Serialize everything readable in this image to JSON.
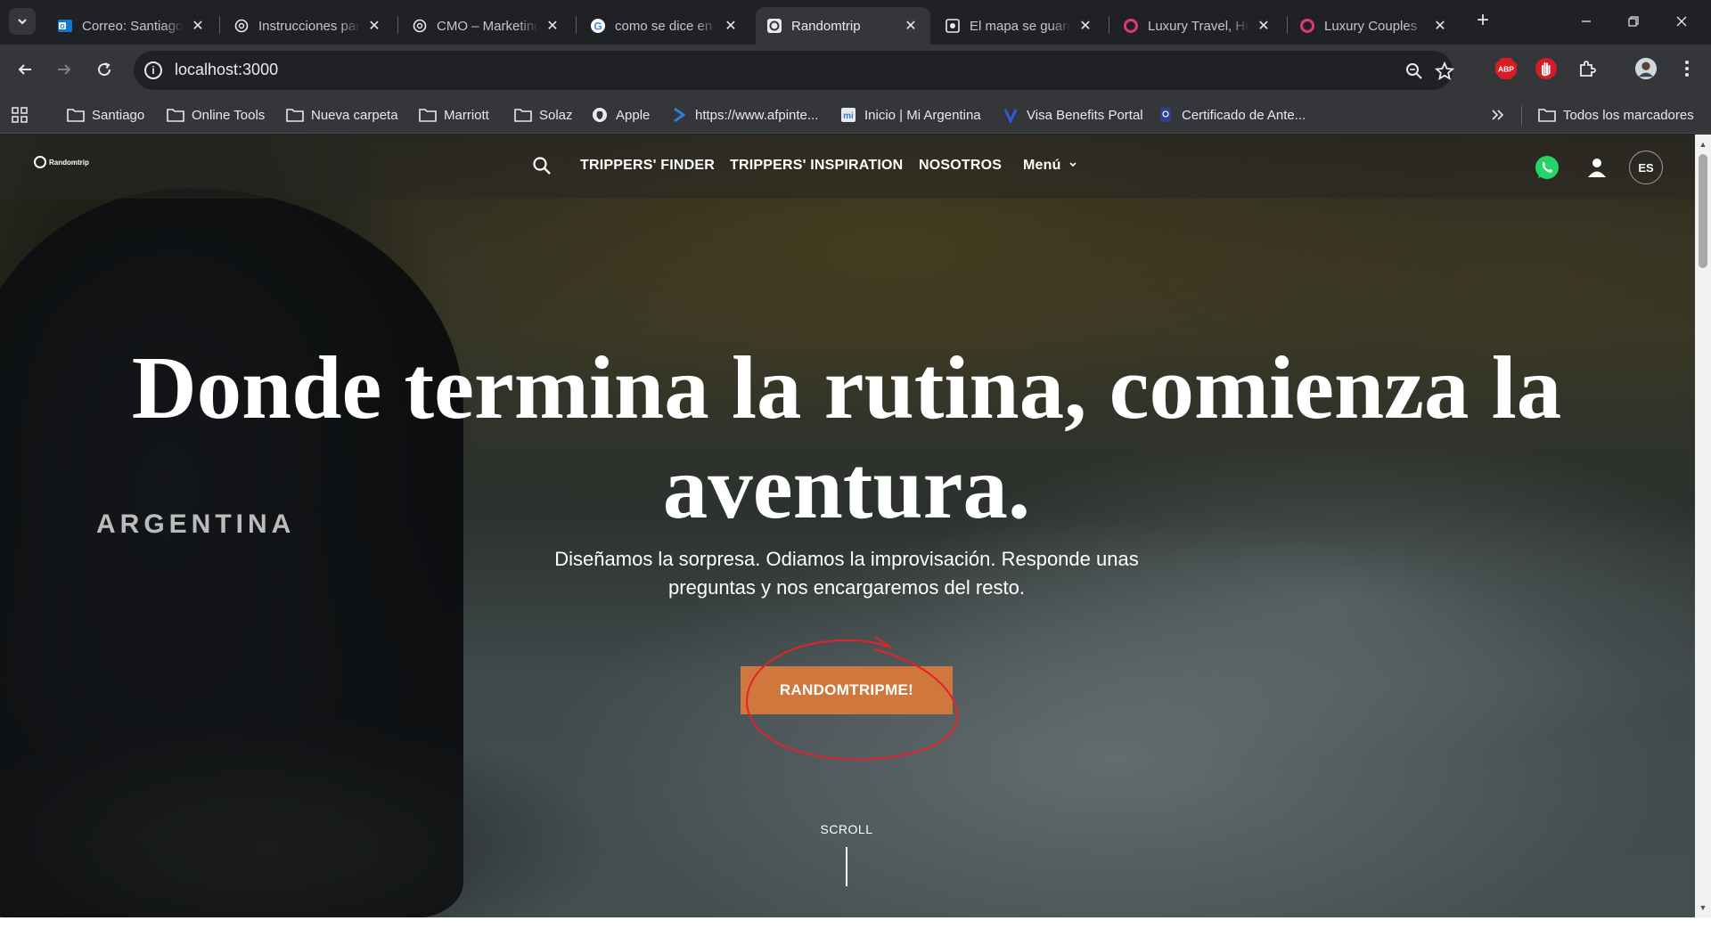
{
  "tabs": [
    {
      "title": "Correo: Santiago",
      "icon": "outlook-icon",
      "active": false
    },
    {
      "title": "Instrucciones para",
      "icon": "openai-icon",
      "active": false
    },
    {
      "title": "CMO – Marketing",
      "icon": "openai-icon",
      "active": false
    },
    {
      "title": "como se dice en",
      "icon": "google-icon",
      "active": false
    },
    {
      "title": "Randomtrip",
      "icon": "randomtrip-icon",
      "active": true
    },
    {
      "title": "El mapa se guarda",
      "icon": "page-icon",
      "active": false
    },
    {
      "title": "Luxury Travel, Hi",
      "icon": "luxury-icon",
      "active": false
    },
    {
      "title": "Luxury Couples",
      "icon": "luxury-icon",
      "active": false
    }
  ],
  "address_bar": {
    "url": "localhost:3000"
  },
  "bookmarks": [
    {
      "label": "Santiago",
      "icon": "folder-icon"
    },
    {
      "label": "Online Tools",
      "icon": "folder-icon"
    },
    {
      "label": "Nueva carpeta",
      "icon": "folder-icon"
    },
    {
      "label": "Marriott",
      "icon": "folder-icon"
    },
    {
      "label": "Solaz",
      "icon": "folder-icon"
    },
    {
      "label": "Apple",
      "icon": "apple-icon"
    },
    {
      "label": "https://www.afpinte...",
      "icon": "afp-icon"
    },
    {
      "label": "Inicio | Mi Argentina",
      "icon": "mi-argentina-icon"
    },
    {
      "label": "Visa Benefits Portal",
      "icon": "visa-icon"
    },
    {
      "label": "Certificado de Ante...",
      "icon": "certificate-icon"
    }
  ],
  "all_bookmarks_label": "Todos los marcadores",
  "site": {
    "logo_text": "Randomtrip",
    "nav": [
      "TRIPPERS' FINDER",
      "TRIPPERS' INSPIRATION",
      "NOSOTROS"
    ],
    "menu_label": "Menú",
    "lang": "ES"
  },
  "hero": {
    "title_line1": "Donde termina la rutina, comienza la",
    "title_line2": "aventura.",
    "location": "ARGENTINA",
    "subtitle": "Diseñamos la sorpresa. Odiamos la improvisación. Responde unas preguntas y nos encargaremos del resto.",
    "cta_label": "RANDOMTRIPME!",
    "scroll_label": "SCROLL"
  },
  "colors": {
    "cta": "#d0773e",
    "annotation": "#e3222b",
    "chrome_dark": "#202124",
    "chrome_toolbar": "#35363a",
    "whatsapp": "#25d366"
  }
}
